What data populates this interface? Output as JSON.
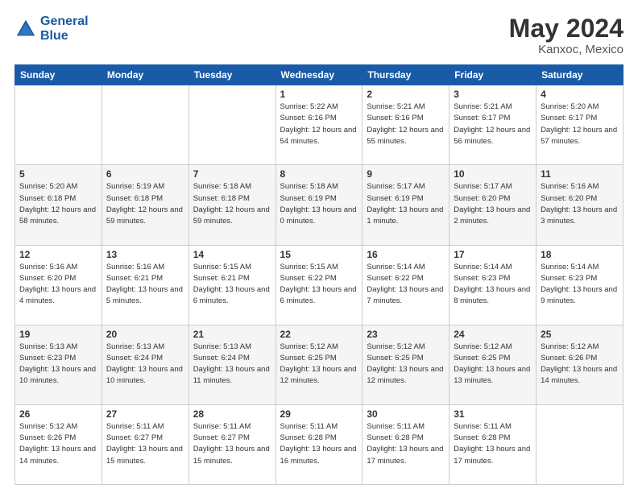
{
  "header": {
    "logo_line1": "General",
    "logo_line2": "Blue",
    "main_title": "May 2024",
    "sub_title": "Kanxoc, Mexico"
  },
  "weekdays": [
    "Sunday",
    "Monday",
    "Tuesday",
    "Wednesday",
    "Thursday",
    "Friday",
    "Saturday"
  ],
  "rows": [
    [
      {
        "day": "",
        "sunrise": "",
        "sunset": "",
        "daylight": ""
      },
      {
        "day": "",
        "sunrise": "",
        "sunset": "",
        "daylight": ""
      },
      {
        "day": "",
        "sunrise": "",
        "sunset": "",
        "daylight": ""
      },
      {
        "day": "1",
        "sunrise": "Sunrise: 5:22 AM",
        "sunset": "Sunset: 6:16 PM",
        "daylight": "Daylight: 12 hours and 54 minutes."
      },
      {
        "day": "2",
        "sunrise": "Sunrise: 5:21 AM",
        "sunset": "Sunset: 6:16 PM",
        "daylight": "Daylight: 12 hours and 55 minutes."
      },
      {
        "day": "3",
        "sunrise": "Sunrise: 5:21 AM",
        "sunset": "Sunset: 6:17 PM",
        "daylight": "Daylight: 12 hours and 56 minutes."
      },
      {
        "day": "4",
        "sunrise": "Sunrise: 5:20 AM",
        "sunset": "Sunset: 6:17 PM",
        "daylight": "Daylight: 12 hours and 57 minutes."
      }
    ],
    [
      {
        "day": "5",
        "sunrise": "Sunrise: 5:20 AM",
        "sunset": "Sunset: 6:18 PM",
        "daylight": "Daylight: 12 hours and 58 minutes."
      },
      {
        "day": "6",
        "sunrise": "Sunrise: 5:19 AM",
        "sunset": "Sunset: 6:18 PM",
        "daylight": "Daylight: 12 hours and 59 minutes."
      },
      {
        "day": "7",
        "sunrise": "Sunrise: 5:18 AM",
        "sunset": "Sunset: 6:18 PM",
        "daylight": "Daylight: 12 hours and 59 minutes."
      },
      {
        "day": "8",
        "sunrise": "Sunrise: 5:18 AM",
        "sunset": "Sunset: 6:19 PM",
        "daylight": "Daylight: 13 hours and 0 minutes."
      },
      {
        "day": "9",
        "sunrise": "Sunrise: 5:17 AM",
        "sunset": "Sunset: 6:19 PM",
        "daylight": "Daylight: 13 hours and 1 minute."
      },
      {
        "day": "10",
        "sunrise": "Sunrise: 5:17 AM",
        "sunset": "Sunset: 6:20 PM",
        "daylight": "Daylight: 13 hours and 2 minutes."
      },
      {
        "day": "11",
        "sunrise": "Sunrise: 5:16 AM",
        "sunset": "Sunset: 6:20 PM",
        "daylight": "Daylight: 13 hours and 3 minutes."
      }
    ],
    [
      {
        "day": "12",
        "sunrise": "Sunrise: 5:16 AM",
        "sunset": "Sunset: 6:20 PM",
        "daylight": "Daylight: 13 hours and 4 minutes."
      },
      {
        "day": "13",
        "sunrise": "Sunrise: 5:16 AM",
        "sunset": "Sunset: 6:21 PM",
        "daylight": "Daylight: 13 hours and 5 minutes."
      },
      {
        "day": "14",
        "sunrise": "Sunrise: 5:15 AM",
        "sunset": "Sunset: 6:21 PM",
        "daylight": "Daylight: 13 hours and 6 minutes."
      },
      {
        "day": "15",
        "sunrise": "Sunrise: 5:15 AM",
        "sunset": "Sunset: 6:22 PM",
        "daylight": "Daylight: 13 hours and 6 minutes."
      },
      {
        "day": "16",
        "sunrise": "Sunrise: 5:14 AM",
        "sunset": "Sunset: 6:22 PM",
        "daylight": "Daylight: 13 hours and 7 minutes."
      },
      {
        "day": "17",
        "sunrise": "Sunrise: 5:14 AM",
        "sunset": "Sunset: 6:23 PM",
        "daylight": "Daylight: 13 hours and 8 minutes."
      },
      {
        "day": "18",
        "sunrise": "Sunrise: 5:14 AM",
        "sunset": "Sunset: 6:23 PM",
        "daylight": "Daylight: 13 hours and 9 minutes."
      }
    ],
    [
      {
        "day": "19",
        "sunrise": "Sunrise: 5:13 AM",
        "sunset": "Sunset: 6:23 PM",
        "daylight": "Daylight: 13 hours and 10 minutes."
      },
      {
        "day": "20",
        "sunrise": "Sunrise: 5:13 AM",
        "sunset": "Sunset: 6:24 PM",
        "daylight": "Daylight: 13 hours and 10 minutes."
      },
      {
        "day": "21",
        "sunrise": "Sunrise: 5:13 AM",
        "sunset": "Sunset: 6:24 PM",
        "daylight": "Daylight: 13 hours and 11 minutes."
      },
      {
        "day": "22",
        "sunrise": "Sunrise: 5:12 AM",
        "sunset": "Sunset: 6:25 PM",
        "daylight": "Daylight: 13 hours and 12 minutes."
      },
      {
        "day": "23",
        "sunrise": "Sunrise: 5:12 AM",
        "sunset": "Sunset: 6:25 PM",
        "daylight": "Daylight: 13 hours and 12 minutes."
      },
      {
        "day": "24",
        "sunrise": "Sunrise: 5:12 AM",
        "sunset": "Sunset: 6:25 PM",
        "daylight": "Daylight: 13 hours and 13 minutes."
      },
      {
        "day": "25",
        "sunrise": "Sunrise: 5:12 AM",
        "sunset": "Sunset: 6:26 PM",
        "daylight": "Daylight: 13 hours and 14 minutes."
      }
    ],
    [
      {
        "day": "26",
        "sunrise": "Sunrise: 5:12 AM",
        "sunset": "Sunset: 6:26 PM",
        "daylight": "Daylight: 13 hours and 14 minutes."
      },
      {
        "day": "27",
        "sunrise": "Sunrise: 5:11 AM",
        "sunset": "Sunset: 6:27 PM",
        "daylight": "Daylight: 13 hours and 15 minutes."
      },
      {
        "day": "28",
        "sunrise": "Sunrise: 5:11 AM",
        "sunset": "Sunset: 6:27 PM",
        "daylight": "Daylight: 13 hours and 15 minutes."
      },
      {
        "day": "29",
        "sunrise": "Sunrise: 5:11 AM",
        "sunset": "Sunset: 6:28 PM",
        "daylight": "Daylight: 13 hours and 16 minutes."
      },
      {
        "day": "30",
        "sunrise": "Sunrise: 5:11 AM",
        "sunset": "Sunset: 6:28 PM",
        "daylight": "Daylight: 13 hours and 17 minutes."
      },
      {
        "day": "31",
        "sunrise": "Sunrise: 5:11 AM",
        "sunset": "Sunset: 6:28 PM",
        "daylight": "Daylight: 13 hours and 17 minutes."
      },
      {
        "day": "",
        "sunrise": "",
        "sunset": "",
        "daylight": ""
      }
    ]
  ]
}
